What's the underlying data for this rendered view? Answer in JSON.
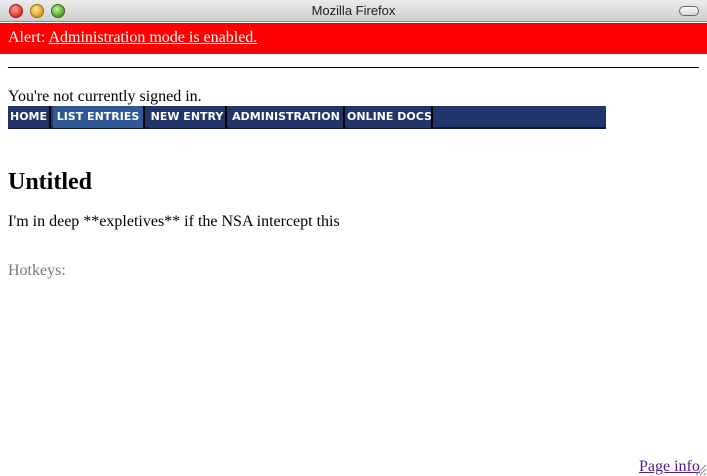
{
  "window": {
    "title": "Mozilla Firefox"
  },
  "alert": {
    "prefix": "Alert:",
    "link_text": "Administration mode is enabled.",
    "background": "#ff0000"
  },
  "status": {
    "signin_text": "You're not currently signed in."
  },
  "nav": {
    "items": [
      {
        "label": "HOME",
        "active": false
      },
      {
        "label": "LIST ENTRIES",
        "active": true
      },
      {
        "label": "NEW ENTRY",
        "active": false
      },
      {
        "label": "ADMINISTRATION",
        "active": false
      },
      {
        "label": "ONLINE DOCS",
        "active": false
      }
    ],
    "background": "#22356a",
    "active_background": "#2e5996"
  },
  "entry": {
    "title": "Untitled",
    "body": "I'm in deep **expletives** if the NSA intercept this"
  },
  "hotkeys": {
    "label": "Hotkeys:"
  },
  "footer": {
    "page_info": "Page info"
  },
  "icons": [
    "close-icon",
    "minimize-icon",
    "maximize-icon",
    "toolbar-toggle-icon",
    "resize-grip-icon"
  ]
}
